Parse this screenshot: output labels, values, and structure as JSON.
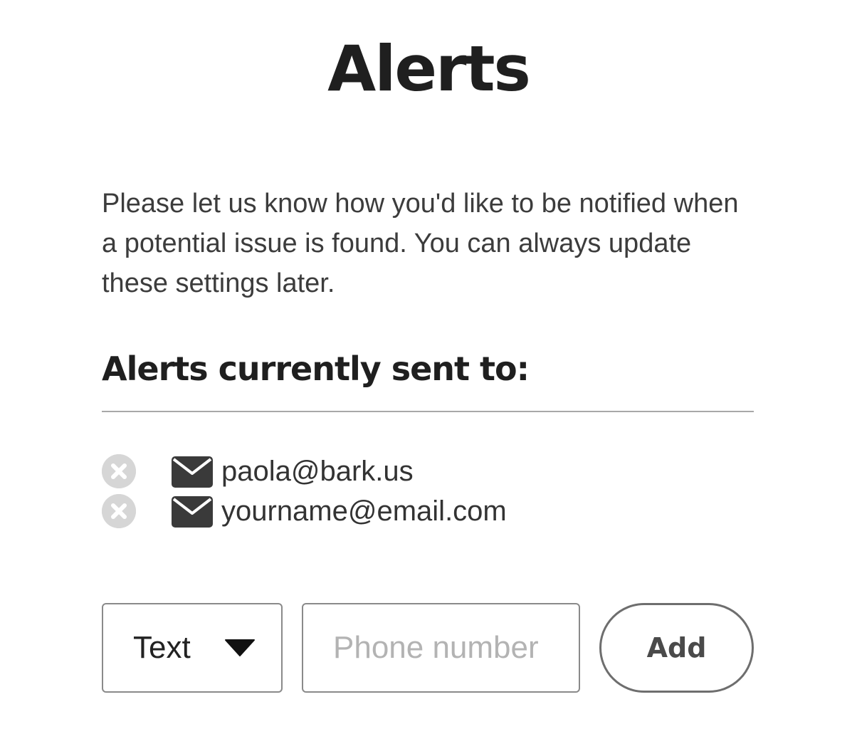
{
  "page": {
    "title": "Alerts",
    "description": "Please let us know how you'd like to be notified when a potential issue is found. You can always update these settings later."
  },
  "recipients_section": {
    "heading": "Alerts currently sent to:",
    "recipients": [
      {
        "email": "paola@bark.us",
        "icon": "mail-icon",
        "remove_icon": "close-circle-icon"
      },
      {
        "email": "yourname@email.com",
        "icon": "mail-icon",
        "remove_icon": "close-circle-icon"
      }
    ]
  },
  "add_form": {
    "method_selected": "Text",
    "method_icon": "caret-down-icon",
    "phone_placeholder": "Phone number",
    "add_label": "Add"
  },
  "colors": {
    "text_primary": "#1f1f1f",
    "text_body": "#3c3c3c",
    "divider": "#a8a8a8",
    "remove_icon_bg": "#d6d6d6",
    "mail_icon": "#3a3a3a",
    "input_border": "#8a8a8a",
    "placeholder": "#b3b3b3",
    "button_border": "#6e6e6e"
  }
}
